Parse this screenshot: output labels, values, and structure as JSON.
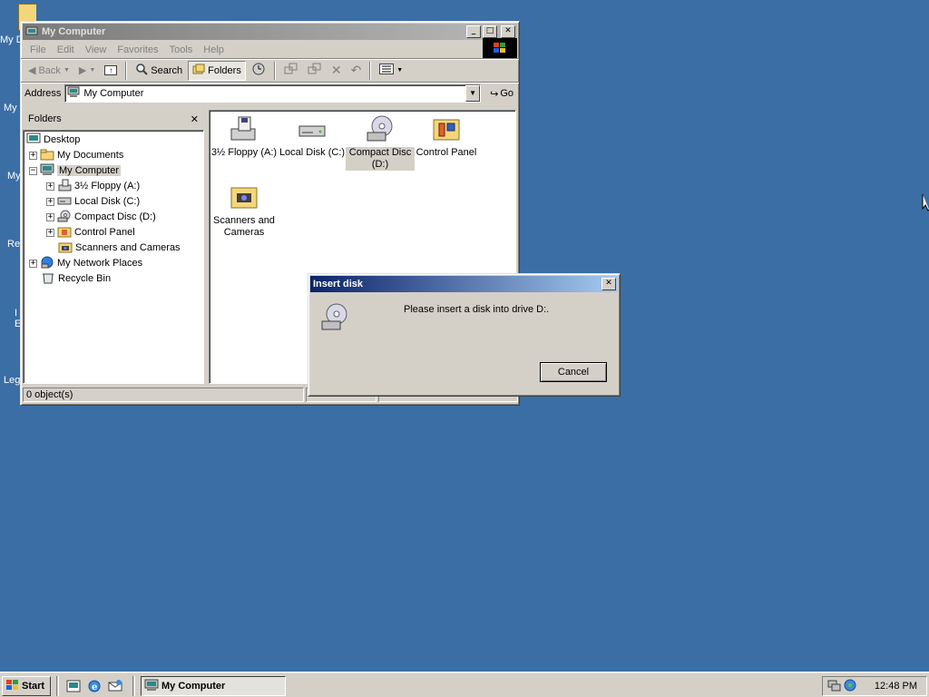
{
  "desktop": {
    "icons": [
      {
        "label": "My D"
      },
      {
        "label": "My"
      },
      {
        "label": "My"
      },
      {
        "label": "Re"
      },
      {
        "label": "I"
      },
      {
        "label": "E"
      },
      {
        "label": "Leg"
      }
    ]
  },
  "explorer": {
    "title": "My Computer",
    "menu": [
      "File",
      "Edit",
      "View",
      "Favorites",
      "Tools",
      "Help"
    ],
    "toolbar": {
      "back_label": "Back",
      "search_label": "Search",
      "folders_label": "Folders"
    },
    "address": {
      "label": "Address",
      "value": "My Computer",
      "go_label": "Go"
    },
    "folders_pane": {
      "title": "Folders",
      "close_glyph": "✕",
      "tree": [
        {
          "label": "Desktop"
        },
        {
          "label": "My Documents",
          "expander": "+"
        },
        {
          "label": "My Computer",
          "expander": "−"
        },
        {
          "label": "3½ Floppy (A:)",
          "expander": "+"
        },
        {
          "label": "Local Disk (C:)",
          "expander": "+"
        },
        {
          "label": "Compact Disc (D:)",
          "expander": "+"
        },
        {
          "label": "Control Panel",
          "expander": "+"
        },
        {
          "label": "Scanners and Cameras"
        },
        {
          "label": "My Network Places",
          "expander": "+"
        },
        {
          "label": "Recycle Bin"
        }
      ]
    },
    "items": [
      {
        "label": "3½ Floppy (A:)"
      },
      {
        "label": "Local Disk (C:)"
      },
      {
        "label": "Compact Disc (D:)"
      },
      {
        "label": "Control Panel"
      },
      {
        "label": "Scanners and Cameras"
      }
    ],
    "status": {
      "objects": "0 object(s)"
    }
  },
  "dialog": {
    "title": "Insert disk",
    "message": "Please insert a disk into drive D:.",
    "cancel_label": "Cancel"
  },
  "taskbar": {
    "start_label": "Start",
    "task_label": "My Computer",
    "clock": "12:48 PM"
  }
}
